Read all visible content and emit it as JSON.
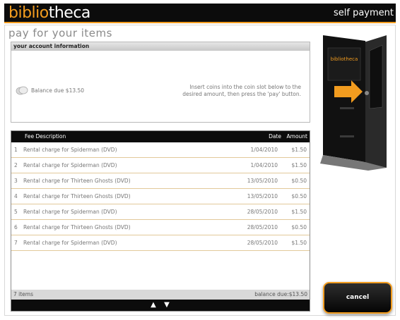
{
  "header": {
    "logo_part1": "biblio",
    "logo_part2": "theca",
    "right_title": "self payment"
  },
  "page": {
    "title": "pay for your items"
  },
  "account": {
    "header": "your account information",
    "balance": "Balance due $13.50",
    "instructions": "Insert coins into the coin slot below to the desired amount, then press the 'pay' button."
  },
  "table": {
    "columns": {
      "description": "Fee Description",
      "date": "Date",
      "amount": "Amount"
    },
    "rows": [
      {
        "num": "1",
        "description": "Rental charge for Spiderman (DVD)",
        "date": "1/04/2010",
        "amount": "$1.50"
      },
      {
        "num": "2",
        "description": "Rental charge for Spiderman (DVD)",
        "date": "1/04/2010",
        "amount": "$1.50"
      },
      {
        "num": "3",
        "description": "Rental charge for Thirteen Ghosts (DVD)",
        "date": "13/05/2010",
        "amount": "$0.50"
      },
      {
        "num": "4",
        "description": "Rental charge for Thirteen Ghosts (DVD)",
        "date": "13/05/2010",
        "amount": "$0.50"
      },
      {
        "num": "5",
        "description": "Rental charge for Spiderman (DVD)",
        "date": "28/05/2010",
        "amount": "$1.50"
      },
      {
        "num": "6",
        "description": "Rental charge for Thirteen Ghosts (DVD)",
        "date": "28/05/2010",
        "amount": "$0.50"
      },
      {
        "num": "7",
        "description": "Rental charge for Spiderman (DVD)",
        "date": "28/05/2010",
        "amount": "$1.50"
      }
    ],
    "footer": {
      "count": "7 items",
      "balance": "balance due:$13.50"
    },
    "nav": {
      "up": "▲",
      "down": "▼"
    }
  },
  "kiosk": {
    "screen_logo": "bibliotheca"
  },
  "actions": {
    "cancel": "cancel"
  },
  "colors": {
    "accent": "#f29c1f",
    "dark": "#0c0c0c"
  }
}
